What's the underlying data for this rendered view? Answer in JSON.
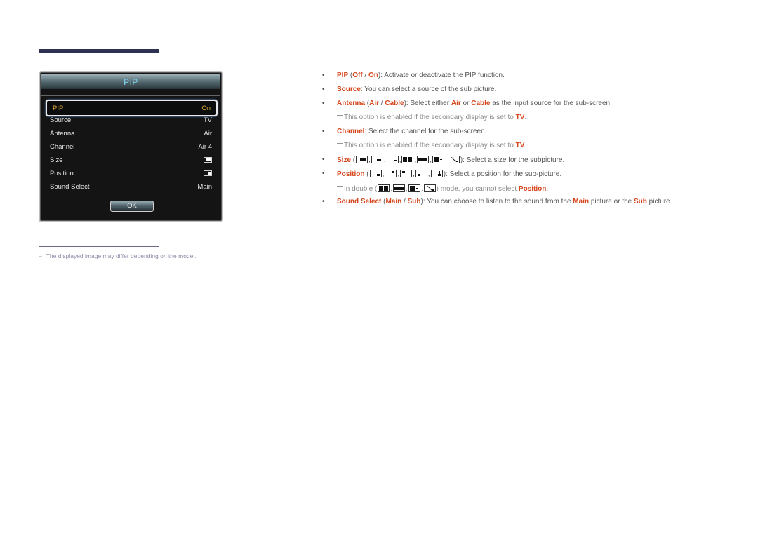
{
  "osd": {
    "title": "PIP",
    "rows": [
      {
        "label": "PIP",
        "value": "On",
        "selected": true
      },
      {
        "label": "Source",
        "value": "TV"
      },
      {
        "label": "Antenna",
        "value": "Air"
      },
      {
        "label": "Channel",
        "value": "Air 4"
      },
      {
        "label": "Size",
        "value": "",
        "icon": "size-icon"
      },
      {
        "label": "Position",
        "value": "",
        "icon": "position-icon"
      },
      {
        "label": "Sound Select",
        "value": "Main"
      }
    ],
    "ok_label": "OK"
  },
  "footnote": {
    "dash": "–",
    "text": "The displayed image may differ depending on the model."
  },
  "items": {
    "pip": {
      "key": "PIP",
      "open": " (",
      "opt1": "Off",
      "sep": " / ",
      "opt2": "On",
      "rest": "): Activate or deactivate the PIP function."
    },
    "source": {
      "key": "Source",
      "rest": ": You can select a source of the sub picture."
    },
    "antenna": {
      "key": "Antenna",
      "open": " (",
      "opt1": "Air",
      "sep": " / ",
      "opt2": "Cable",
      "mid": "): Select either ",
      "k3": "Air",
      "or": " or ",
      "k4": "Cable",
      "rest": " as the input source for the sub-screen."
    },
    "antenna_note": {
      "text": "This option is enabled if the secondary display is set to ",
      "key": "TV",
      "end": "."
    },
    "channel": {
      "key": "Channel",
      "rest": ": Select the channel for the sub-screen."
    },
    "channel_note": {
      "text": "This option is enabled if the secondary display is set to ",
      "key": "TV",
      "end": "."
    },
    "size": {
      "key": "Size",
      "open": " (",
      "rest": "): Select a size for the subpicture."
    },
    "position": {
      "key": "Position",
      "open": " (",
      "rest": "): Select a position for the sub-picture."
    },
    "position_note": {
      "text": "In double (",
      "rest": ") mode, you cannot select ",
      "key": "Position",
      "end": "."
    },
    "sound": {
      "key": "Sound Select",
      "open": " (",
      "opt1": "Main",
      "sep": " / ",
      "opt2": "Sub",
      "mid": "): You can choose to listen to the sound from the ",
      "k3": "Main",
      "mid2": " picture or the ",
      "k4": "Sub",
      "rest": " picture."
    }
  },
  "bullet": "•",
  "colors": {
    "accent": "#d6451b",
    "osd_selected": "#e5b23b",
    "osd_title": "#7fd4f0"
  }
}
